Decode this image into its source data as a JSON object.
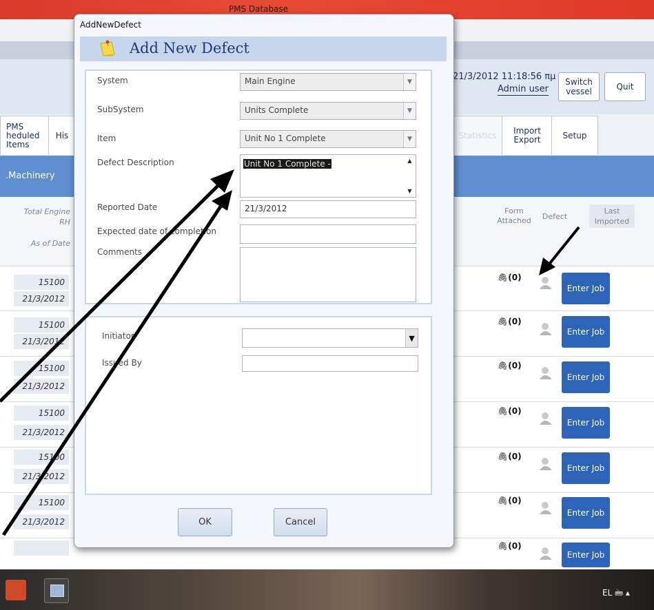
{
  "window": {
    "title": "PMS Database"
  },
  "header": {
    "datetime": "21/3/2012 11:18:56 πμ",
    "user": "Admin user",
    "switch_vessel_label": "Switch vessel",
    "quit_label": "Quit"
  },
  "tabs": {
    "pms": "PMS\nheduled\nItems",
    "his": "His",
    "statistics": "Statistics",
    "import_export": "Import\nExport",
    "setup": "Setup"
  },
  "section": {
    "label": ".Machinery"
  },
  "columns": {
    "total_engine_rh": "Total Engine\nRH",
    "as_of_date": "As of Date",
    "form_attached": "Form\nAttached",
    "defect": "Defect",
    "last_imported": "Last\nImported"
  },
  "rows": [
    {
      "rh": "15100",
      "date": "21/3/2012",
      "attached": "(0)",
      "button": "Enter Job"
    },
    {
      "rh": "15100",
      "date": "21/3/2012",
      "attached": "(0)",
      "button": "Enter Job"
    },
    {
      "rh": "15100",
      "date": "21/3/2012",
      "attached": "(0)",
      "button": "Enter Job"
    },
    {
      "rh": "15100",
      "date": "21/3/2012",
      "attached": "(0)",
      "button": "Enter Job"
    },
    {
      "rh": "15100",
      "date": "21/3/2012",
      "attached": "(0)",
      "button": "Enter Job"
    },
    {
      "rh": "15100",
      "date": "21/3/2012",
      "attached": "(0)",
      "button": "Enter Job"
    },
    {
      "rh": "",
      "date": "",
      "attached": "(0)",
      "button": "Enter Job"
    }
  ],
  "dialog": {
    "window_title": "AddNewDefect",
    "heading": "Add New Defect",
    "system_label": "System",
    "system_value": "Main Engine",
    "subsystem_label": "SubSystem",
    "subsystem_value": "Units Complete",
    "item_label": "Item",
    "item_value": "Unit No 1 Complete",
    "description_label": "Defect Description",
    "description_value": "Unit No 1 Complete -",
    "reported_date_label": "Reported Date",
    "reported_date_value": "21/3/2012",
    "expected_date_label": "Expected date of completion",
    "expected_date_value": "",
    "comments_label": "Comments",
    "comments_value": "",
    "initiator_label": "Initiator",
    "initiator_value": "",
    "issued_by_label": "Issued By",
    "issued_by_value": "",
    "ok_label": "OK",
    "cancel_label": "Cancel"
  },
  "taskbar": {
    "language": "EL"
  }
}
